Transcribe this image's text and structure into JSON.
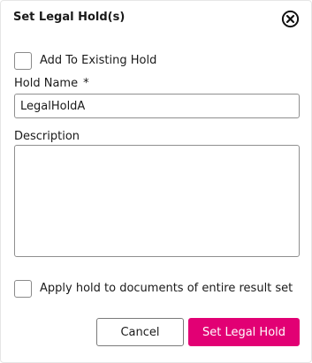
{
  "dialog": {
    "title": "Set Legal Hold(s)",
    "close_icon": "close-circle-x-icon"
  },
  "add_to_existing": {
    "label": "Add To Existing Hold",
    "checked": false
  },
  "hold_name": {
    "label": "Hold Name",
    "required_marker": "*",
    "value": "LegalHoldA"
  },
  "description": {
    "label": "Description",
    "value": ""
  },
  "apply_entire_result_set": {
    "label": "Apply hold to documents of entire result set",
    "checked": false
  },
  "buttons": {
    "cancel_label": "Cancel",
    "submit_label": "Set Legal Hold"
  },
  "colors": {
    "primary": "#e20074",
    "border": "#8f8f8f"
  }
}
